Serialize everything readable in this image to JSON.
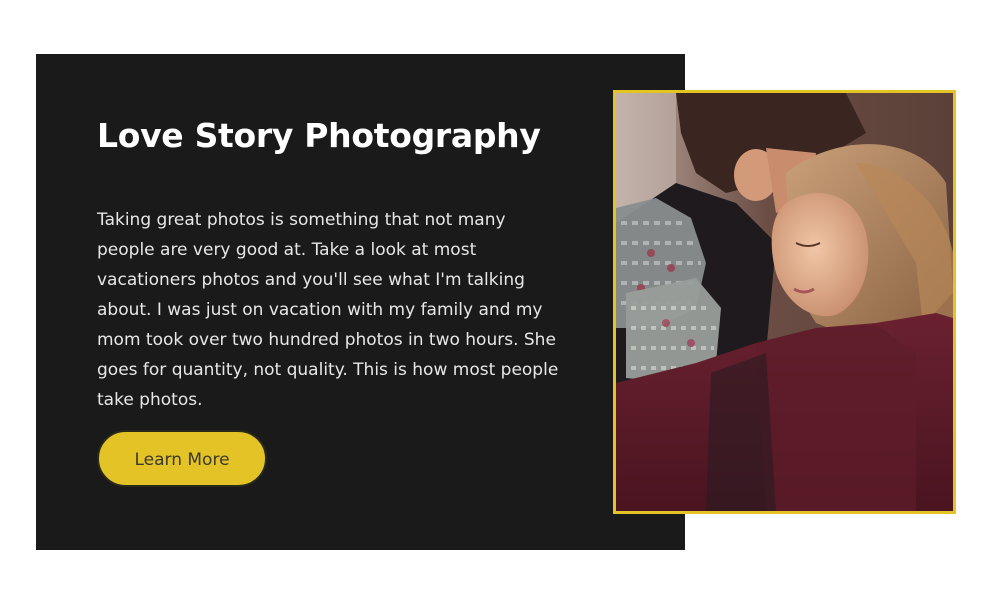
{
  "card": {
    "title": "Love Story Photography",
    "body": "Taking great photos is something that not many people are very good at. Take a look at most vacationers photos and you'll see what I'm talking about. I was just on vacation with my family and my mom took over two hundred photos in two hours. She goes for quantity, not quality. This is how most people take photos.",
    "button_label": "Learn More"
  },
  "colors": {
    "panel_background": "#1a1a1a",
    "accent": "#e3c326",
    "title_text": "#ffffff",
    "body_text": "#e7e7e7"
  },
  "image": {
    "subject": "couple-embrace-photo"
  }
}
